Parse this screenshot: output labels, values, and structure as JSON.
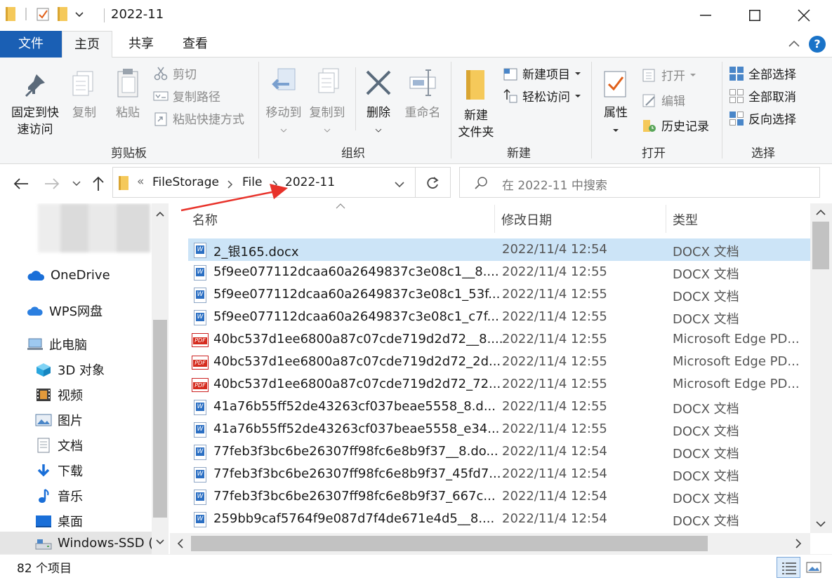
{
  "window": {
    "title": "2022-11"
  },
  "tabs": {
    "file": "文件",
    "home": "主页",
    "share": "共享",
    "view": "查看"
  },
  "ribbon": {
    "clipboard": {
      "group": "剪贴板",
      "pin_line1": "固定到快",
      "pin_line2": "速访问",
      "copy": "复制",
      "paste": "粘贴",
      "cut": "剪切",
      "copy_path": "复制路径",
      "paste_shortcut": "粘贴快捷方式"
    },
    "organize": {
      "group": "组织",
      "move_to": "移动到",
      "copy_to": "复制到",
      "delete": "删除",
      "rename": "重命名"
    },
    "new": {
      "group": "新建",
      "new_folder_line1": "新建",
      "new_folder_line2": "文件夹",
      "new_item": "新建项目",
      "easy_access": "轻松访问"
    },
    "open": {
      "group": "打开",
      "properties": "属性",
      "open": "打开",
      "edit": "编辑",
      "history": "历史记录"
    },
    "select": {
      "group": "选择",
      "select_all": "全部选择",
      "select_none": "全部取消",
      "invert": "反向选择"
    }
  },
  "address": {
    "prefix": "«",
    "crumbs": [
      "FileStorage",
      "File",
      "2022-11"
    ],
    "search_placeholder": "在 2022-11 中搜索"
  },
  "nav": {
    "onedrive": "OneDrive",
    "wps": "WPS网盘",
    "this_pc": "此电脑",
    "objects3d": "3D 对象",
    "videos": "视频",
    "pictures": "图片",
    "documents": "文档",
    "downloads": "下载",
    "music": "音乐",
    "desktop": "桌面",
    "drive": "Windows-SSD (C"
  },
  "columns": {
    "name": "名称",
    "date": "修改日期",
    "type": "类型"
  },
  "files": [
    {
      "name": "2_银165.docx",
      "date": "2022/11/4 12:54",
      "type": "DOCX 文档",
      "kind": "docx"
    },
    {
      "name": "5f9ee077112dcaa60a2649837c3e08c1__8....",
      "date": "2022/11/4 12:55",
      "type": "DOCX 文档",
      "kind": "docx"
    },
    {
      "name": "5f9ee077112dcaa60a2649837c3e08c1_53f...",
      "date": "2022/11/4 12:55",
      "type": "DOCX 文档",
      "kind": "docx"
    },
    {
      "name": "5f9ee077112dcaa60a2649837c3e08c1_c7f...",
      "date": "2022/11/4 12:55",
      "type": "DOCX 文档",
      "kind": "docx"
    },
    {
      "name": "40bc537d1ee6800a87c07cde719d2d72__8....",
      "date": "2022/11/4 12:55",
      "type": "Microsoft Edge PD...",
      "kind": "pdf"
    },
    {
      "name": "40bc537d1ee6800a87c07cde719d2d72_2d...",
      "date": "2022/11/4 12:55",
      "type": "Microsoft Edge PD...",
      "kind": "pdf"
    },
    {
      "name": "40bc537d1ee6800a87c07cde719d2d72_72...",
      "date": "2022/11/4 12:55",
      "type": "Microsoft Edge PD...",
      "kind": "pdf"
    },
    {
      "name": "41a76b55ff52de43263cf037beae5558_8.d...",
      "date": "2022/11/4 12:55",
      "type": "DOCX 文档",
      "kind": "docx"
    },
    {
      "name": "41a76b55ff52de43263cf037beae5558_e34...",
      "date": "2022/11/4 12:55",
      "type": "DOCX 文档",
      "kind": "docx"
    },
    {
      "name": "77feb3f3bc6be26307ff98fc6e8b9f37__8.do...",
      "date": "2022/11/4 12:54",
      "type": "DOCX 文档",
      "kind": "docx"
    },
    {
      "name": "77feb3f3bc6be26307ff98fc6e8b9f37_45fd7...",
      "date": "2022/11/4 12:54",
      "type": "DOCX 文档",
      "kind": "docx"
    },
    {
      "name": "77feb3f3bc6be26307ff98fc6e8b9f37_667c...",
      "date": "2022/11/4 12:54",
      "type": "DOCX 文档",
      "kind": "docx"
    },
    {
      "name": "259bb9caf5764f9e087d7f4de671e4d5__8....",
      "date": "2022/11/4 12:54",
      "type": "DOCX 文档",
      "kind": "docx"
    }
  ],
  "status": {
    "count": "82 个项目"
  },
  "colors": {
    "accent": "#1a5fb4",
    "selection": "#cce4f7",
    "annotation_arrow": "#e8322a"
  }
}
